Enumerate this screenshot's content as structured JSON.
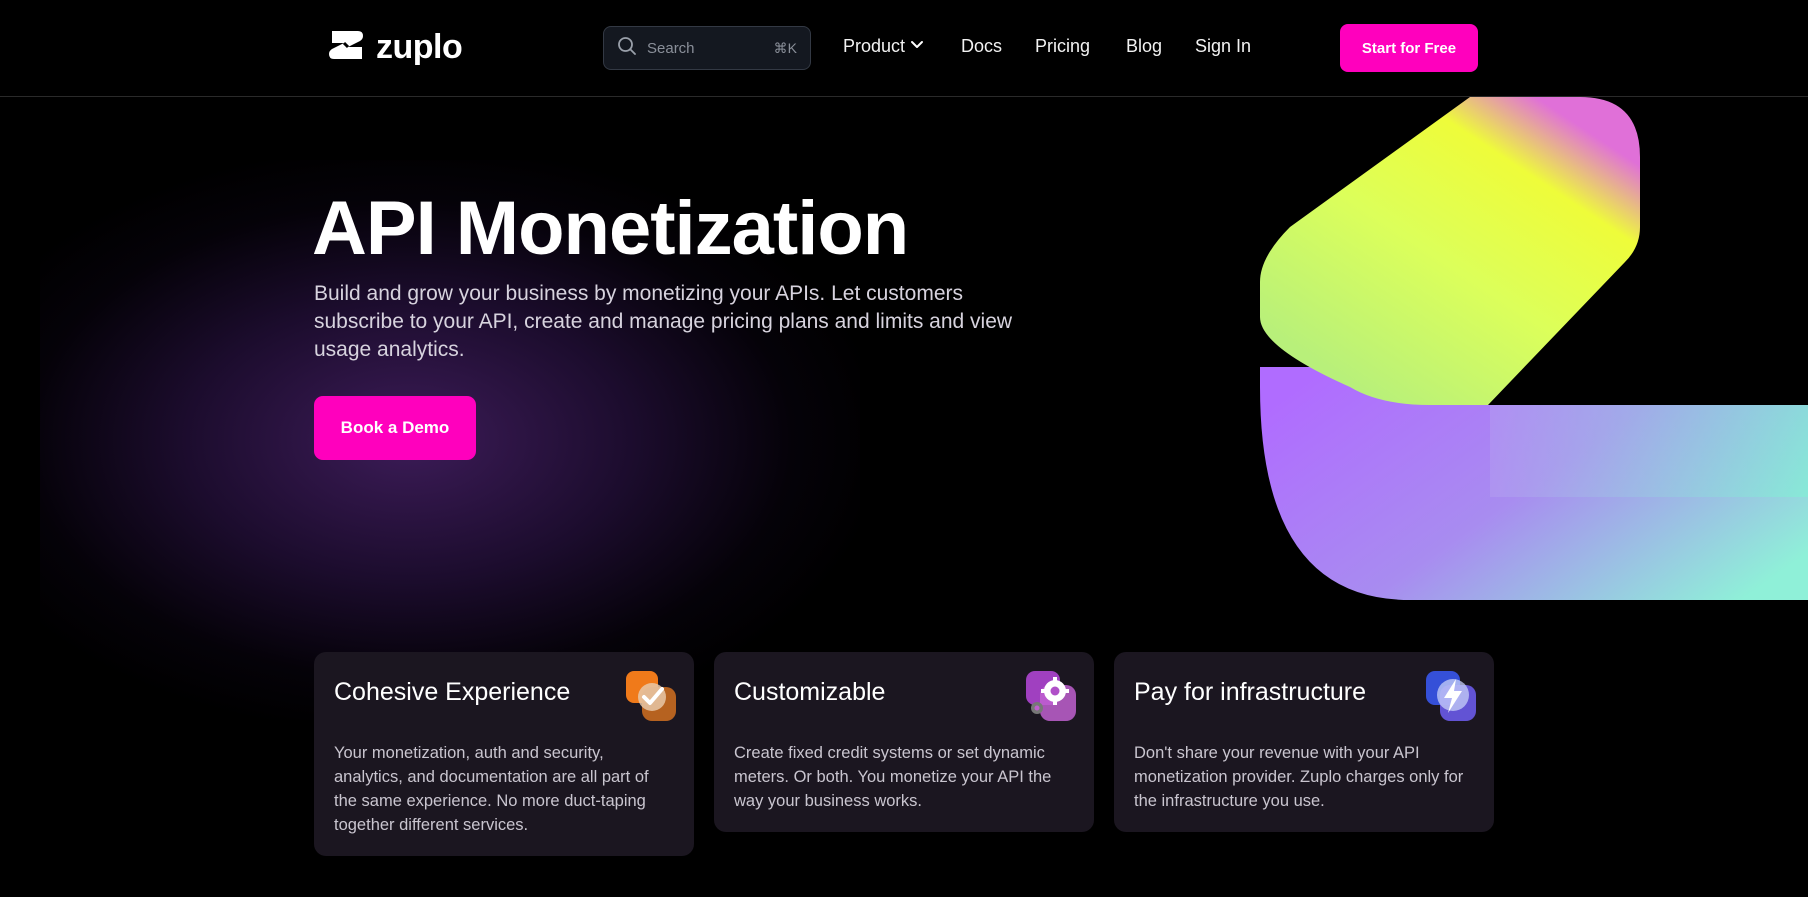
{
  "header": {
    "logo_text": "zuplo",
    "search": {
      "placeholder": "Search",
      "shortcut": "⌘K"
    },
    "nav": [
      {
        "label": "Product",
        "has_dropdown": true
      },
      {
        "label": "Docs"
      },
      {
        "label": "Pricing"
      },
      {
        "label": "Blog"
      },
      {
        "label": "Sign In"
      }
    ],
    "cta_label": "Start for Free"
  },
  "hero": {
    "title": "API Monetization",
    "subtitle": "Build and grow your business by monetizing your APIs. Let customers subscribe to your API, create and manage pricing plans and limits and view usage analytics.",
    "cta_label": "Book a Demo"
  },
  "features": [
    {
      "title": "Cohesive Experience",
      "body": "Your monetization, auth and security, analytics, and documentation are all part of the same experience. No more duct-taping together different services.",
      "icon": "check-badge-icon"
    },
    {
      "title": "Customizable",
      "body": "Create fixed credit systems or set dynamic meters. Or both. You monetize your API the way your business works.",
      "icon": "gears-icon"
    },
    {
      "title": "Pay for infrastructure",
      "body": "Don't share your revenue with your API monetization provider. Zuplo charges only for the infrastructure you use.",
      "icon": "lightning-icon"
    }
  ],
  "colors": {
    "accent": "#ff00bd",
    "background": "#000000",
    "card_background": "#1b1620"
  }
}
